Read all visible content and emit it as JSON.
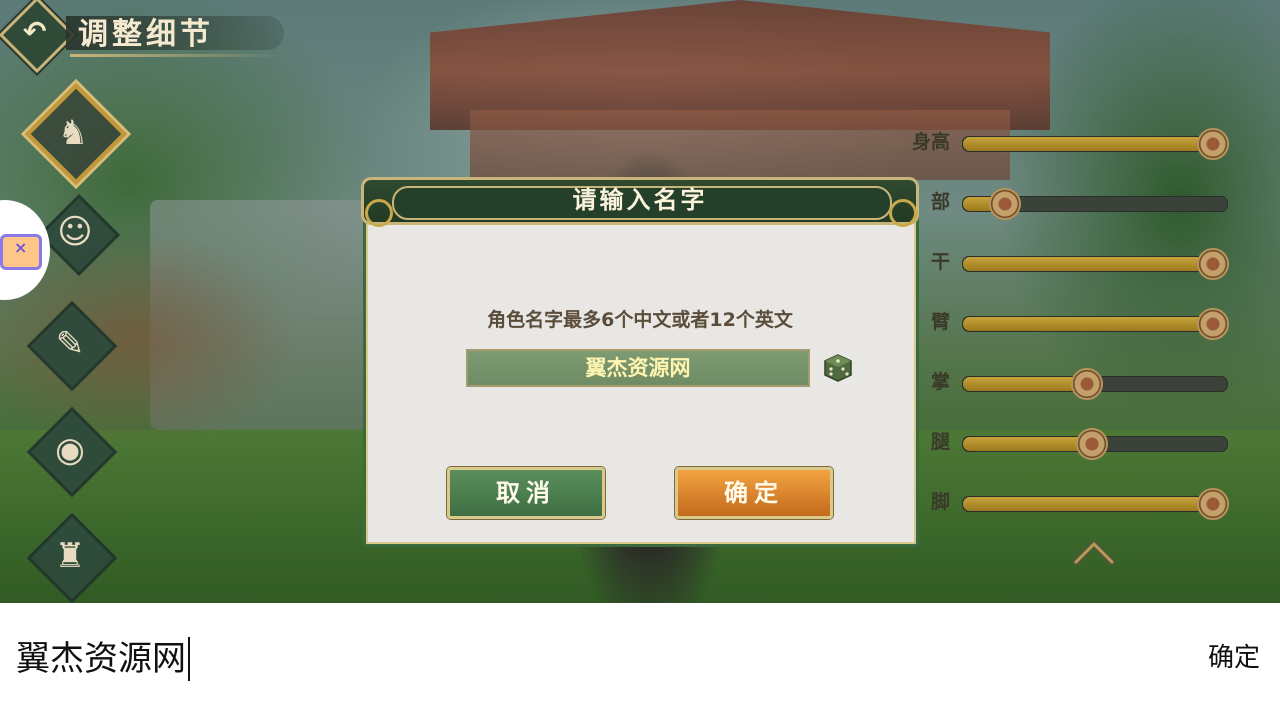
{
  "header": {
    "title": "调整细节"
  },
  "categories": [
    {
      "name": "hair",
      "active": true
    },
    {
      "name": "face",
      "active": false
    },
    {
      "name": "makeup",
      "active": false
    },
    {
      "name": "eyes",
      "active": false
    },
    {
      "name": "clothes",
      "active": false
    }
  ],
  "sliders": [
    {
      "label": "身高",
      "value": 1.0
    },
    {
      "label": "部",
      "value": 0.16
    },
    {
      "label": "干",
      "value": 1.0
    },
    {
      "label": "臂",
      "value": 1.0
    },
    {
      "label": "掌",
      "value": 0.47
    },
    {
      "label": "腿",
      "value": 0.49
    },
    {
      "label": "脚",
      "value": 1.0
    }
  ],
  "dialog": {
    "title": "请输入名字",
    "hint": "角色名字最多6个中文或者12个英文",
    "name_value": "翼杰资源网",
    "cancel_label": "取消",
    "confirm_label": "确定"
  },
  "ime": {
    "text": "翼杰资源网",
    "confirm_label": "确定"
  },
  "colors": {
    "dialog_header": "#2f4a2f",
    "gold_border": "#c9b57a",
    "cancel_button": "#4f824f",
    "confirm_button": "#de8a2e",
    "slider_fill": "#c6a33a"
  }
}
